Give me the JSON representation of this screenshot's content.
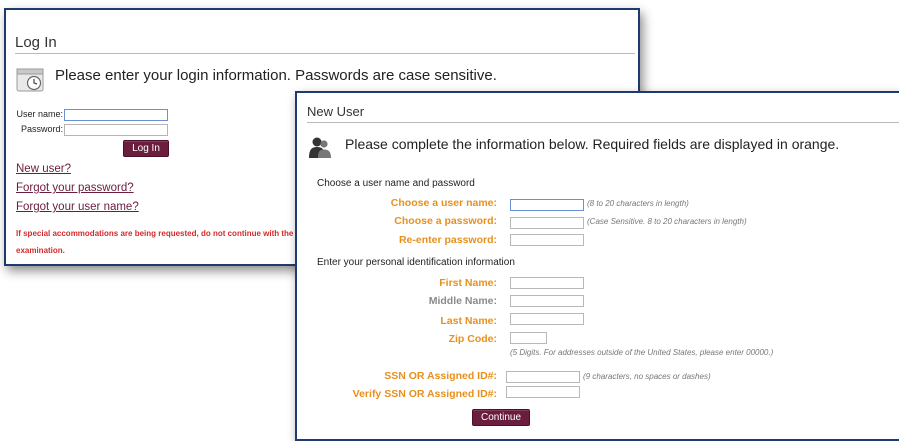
{
  "login": {
    "title": "Log In",
    "intro": "Please enter your login information. Passwords are case sensitive.",
    "username_label": "User name:",
    "username_value": "",
    "password_label": "Password:",
    "password_value": "",
    "login_button": "Log In",
    "links": {
      "new_user": "New user?",
      "forgot_password": "Forgot your password?",
      "forgot_username": "Forgot your user name?"
    },
    "warning_line1": "If special accommodations are being requested, do not continue with the c",
    "warning_line2": "examination."
  },
  "new_user": {
    "title": "New User",
    "intro": "Please complete the information below. Required fields are displayed in orange.",
    "section_credentials": "Choose a user name and password",
    "section_identity": "Enter your personal identification information",
    "fields": {
      "username": {
        "label": "Choose a user name:",
        "hint": "(8 to 20 characters in length)",
        "required": true
      },
      "password": {
        "label": "Choose a password:",
        "hint": "(Case Sensitive. 8 to 20 characters in length)",
        "required": true
      },
      "reenter_password": {
        "label": "Re-enter password:",
        "hint": "",
        "required": true
      },
      "first_name": {
        "label": "First Name:",
        "required": true
      },
      "middle_name": {
        "label": "Middle Name:",
        "required": false
      },
      "last_name": {
        "label": "Last Name:",
        "required": true
      },
      "zip_code": {
        "label": "Zip Code:",
        "hint": "(5 Digits. For addresses outside of the United States, please enter 00000.)",
        "required": true
      },
      "ssn": {
        "label": "SSN OR Assigned ID#:",
        "hint": "(9 characters, no spaces or dashes)",
        "required": true
      },
      "verify_ssn": {
        "label": "Verify SSN OR Assigned ID#:",
        "required": true
      }
    },
    "continue_button": "Continue"
  },
  "colors": {
    "border_blue": "#1f3a6e",
    "maroon": "#6b1d3e",
    "required_orange": "#e8901c",
    "optional_gray": "#8a8a8a",
    "warning_red": "#d42a2a"
  },
  "icons": {
    "login_intro": "clock-icon",
    "new_user_intro": "user-silhouette-icon"
  }
}
